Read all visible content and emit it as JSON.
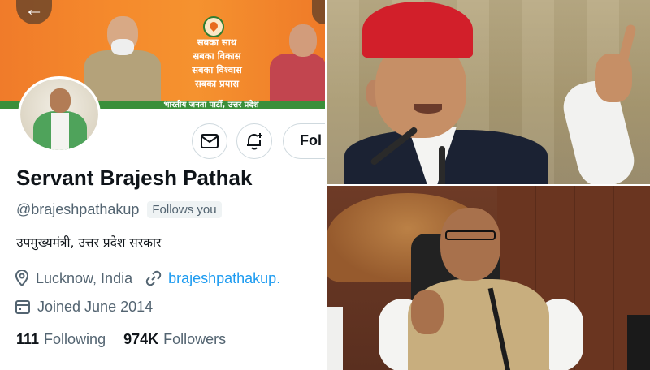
{
  "banner": {
    "slogan_lines": [
      "सबका साथ",
      "सबका विकास",
      "सबका विश्वास",
      "सबका प्रयास"
    ],
    "party": "भारतीय जनता पार्टी, उत्तर प्रदेश"
  },
  "profile": {
    "display_name": "Servant Brajesh Pathak",
    "handle": "@brajeshpathakup",
    "follows_you": "Follows you",
    "bio": "उपमुख्यमंत्री, उत्तर प्रदेश सरकार",
    "location": "Lucknow, India",
    "website": "brajeshpathakup.",
    "joined": "Joined June 2014",
    "following_count": "111",
    "following_label": "Following",
    "followers_count": "974K",
    "followers_label": "Followers"
  },
  "actions": {
    "follow_label": "Fol"
  },
  "colors": {
    "link": "#1d9bf0",
    "secondary_text": "#536471",
    "primary_text": "#0f1419",
    "banner_orange": "#f58a2c",
    "cap_red": "#d21f2a"
  },
  "icons": {
    "back": "arrow-left-icon",
    "message": "envelope-icon",
    "notify": "bell-plus-icon",
    "location": "map-pin-icon",
    "link": "link-icon",
    "calendar": "calendar-icon"
  }
}
